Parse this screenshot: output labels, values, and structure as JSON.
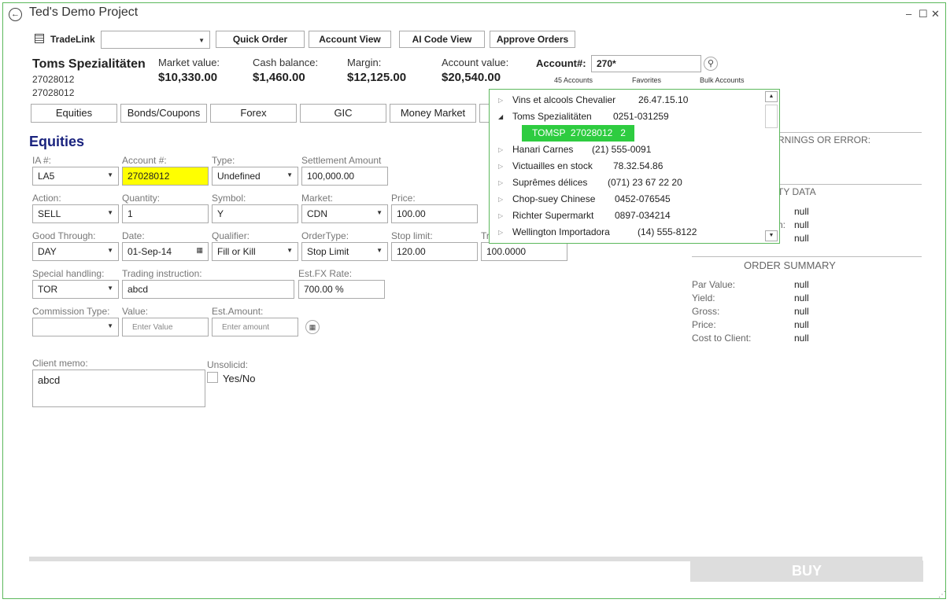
{
  "window": {
    "title": "Ted's Demo Project",
    "controls": [
      "–",
      "☐",
      "✕"
    ]
  },
  "toolbar": {
    "tradelink_label": "TradeLink",
    "tradelink_value": "",
    "buttons": [
      "Quick Order",
      "Account View",
      "AI Code View",
      "Approve Orders"
    ]
  },
  "account": {
    "name": "Toms Spezialitäten",
    "num1": "27028012",
    "num2": "27028012",
    "stats": [
      {
        "label": "Market value:",
        "value": "$10,330.00"
      },
      {
        "label": "Cash balance:",
        "value": "$1,460.00"
      },
      {
        "label": "Margin:",
        "value": "$12,125.00"
      },
      {
        "label": "Account value:",
        "value": "$20,540.00"
      }
    ],
    "search_label": "Account#:",
    "search_value": "270*",
    "links": [
      "45 Accounts",
      "Favorites",
      "Bulk Accounts"
    ]
  },
  "tabs": [
    "Equities",
    "Bonds/Coupons",
    "Forex",
    "GIC",
    "Money Market"
  ],
  "form": {
    "section_title": "Equities",
    "ia_label": "IA #:",
    "ia_value": "LA5",
    "acct_label": "Account #:",
    "acct_value": "27028012",
    "type_label": "Type:",
    "type_value": "Undefined",
    "settle_label": "Settlement Amount",
    "settle_value": "100,000.00",
    "action_label": "Action:",
    "action_value": "SELL",
    "qty_label": "Quantity:",
    "qty_value": "1",
    "symbol_label": "Symbol:",
    "symbol_value": "Y",
    "market_label": "Market:",
    "market_value": "CDN",
    "price_label": "Price:",
    "price_value": "100.00",
    "good_label": "Good Through:",
    "good_value": "DAY",
    "date_label": "Date:",
    "date_value": "01-Sep-14",
    "qual_label": "Qualifier:",
    "qual_value": "Fill or Kill",
    "ordertype_label": "OrderType:",
    "ordertype_value": "Stop Limit",
    "stop_label": "Stop limit:",
    "stop_value": "120.00",
    "tr_label": "Tr",
    "tr_value": "100.0000",
    "special_label": "Special handling:",
    "special_value": "TOR",
    "trading_label": "Trading instruction:",
    "trading_value": "abcd",
    "fx_label": "Est.FX Rate:",
    "fx_value": "700.00 %",
    "comm_label": "Commission Type:",
    "comm_value": "",
    "value_label": "Value:",
    "value_placeholder": "Enter Value",
    "estamt_label": "Est.Amount:",
    "estamt_placeholder": "Enter amount",
    "memo_label": "Client memo:",
    "memo_value": "abcd",
    "unsolicit_label": "Unsolicid:",
    "unsolicit_option": "Yes/No"
  },
  "right_panel": {
    "warnings": "RNINGS OR ERROR:",
    "security": "TY DATA",
    "sec_values": [
      "null",
      "null",
      "null"
    ],
    "sec_partial_label": "n:",
    "order_summary": "ORDER SUMMARY",
    "rows": [
      {
        "label": "Par Value:",
        "value": "null"
      },
      {
        "label": "Yield:",
        "value": "null"
      },
      {
        "label": "Gross:",
        "value": "null"
      },
      {
        "label": "Price:",
        "value": "null"
      },
      {
        "label": "Cost to Client:",
        "value": "null"
      }
    ]
  },
  "dropdown": {
    "items": [
      {
        "name": "Vins et alcools Chevalier",
        "phone": "26.47.15.10"
      },
      {
        "name": "Toms Spezialitäten",
        "phone": "0251-031259",
        "expanded": true
      },
      {
        "name": "TOMSP  27028012   2",
        "phone": "",
        "child": true
      },
      {
        "name": "Hanari Carnes",
        "phone": "(21) 555-0091"
      },
      {
        "name": "Victuailles en stock",
        "phone": "78.32.54.86"
      },
      {
        "name": "Suprêmes délices",
        "phone": "(071) 23 67 22 20"
      },
      {
        "name": "Chop-suey Chinese",
        "phone": "0452-076545"
      },
      {
        "name": "Richter Supermarkt",
        "phone": "0897-034214"
      },
      {
        "name": "Wellington Importadora",
        "phone": "(14) 555-8122"
      }
    ]
  },
  "buy_label": "BUY",
  "colors": {
    "accent": "#5cb85c",
    "highlight": "#ffff00",
    "selected": "#2ecc40",
    "section": "#1a237e"
  }
}
